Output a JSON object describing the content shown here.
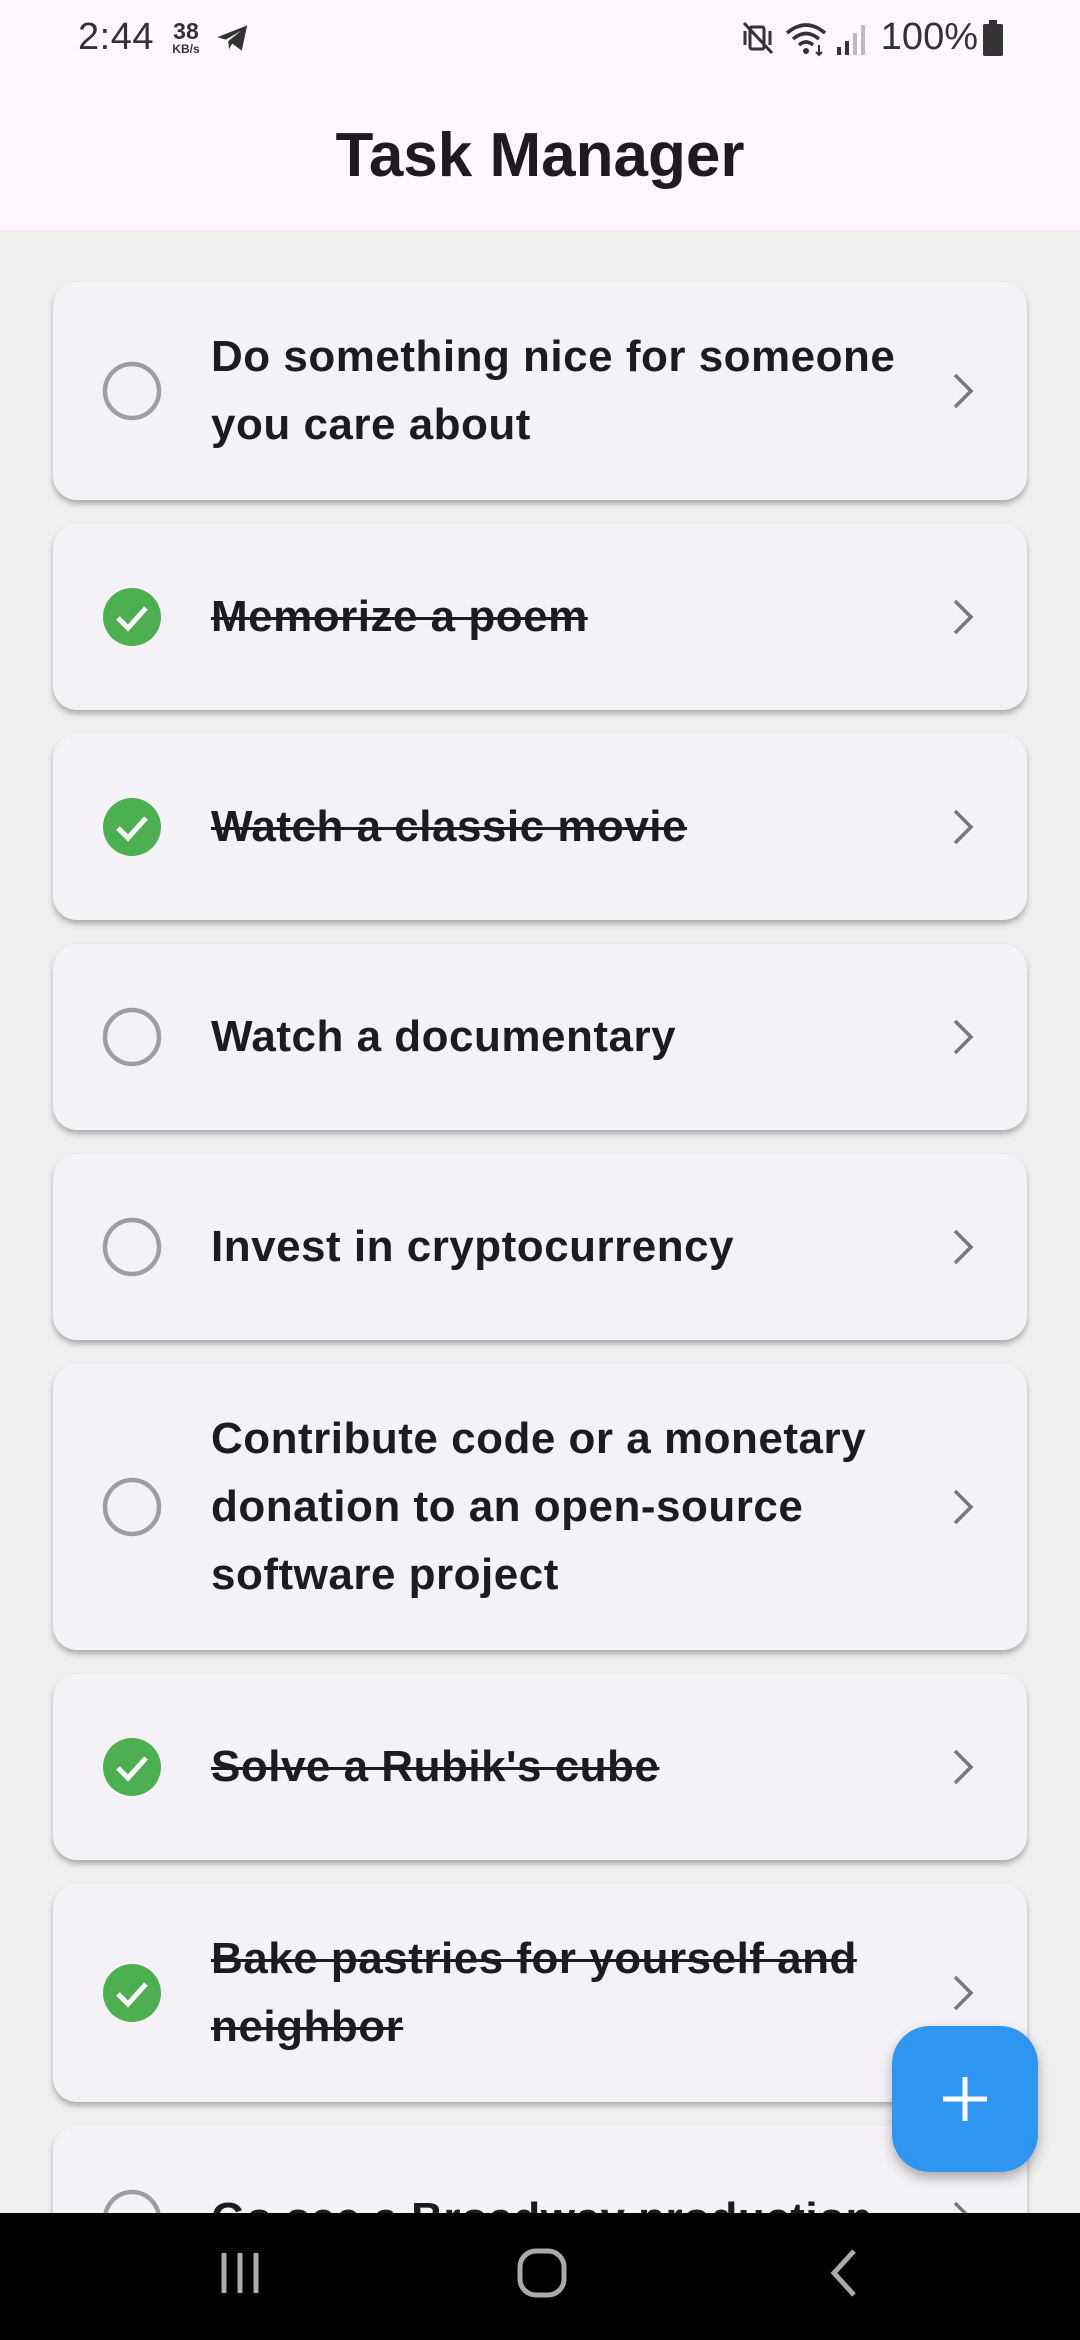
{
  "status_bar": {
    "time": "2:44",
    "net_speed_value": "38",
    "net_speed_unit": "KB/s",
    "battery": "100%"
  },
  "app_bar": {
    "title": "Task Manager"
  },
  "tasks": [
    {
      "title": "Do something nice for someone you care about",
      "completed": false
    },
    {
      "title": "Memorize a poem",
      "completed": true
    },
    {
      "title": "Watch a classic movie",
      "completed": true
    },
    {
      "title": "Watch a documentary",
      "completed": false
    },
    {
      "title": "Invest in cryptocurrency",
      "completed": false
    },
    {
      "title": "Contribute code or a monetary donation to an open-source software project",
      "completed": false
    },
    {
      "title": "Solve a Rubik's cube",
      "completed": true
    },
    {
      "title": "Bake pastries for yourself and neighbor",
      "completed": true
    },
    {
      "title": "Go see a Broadway production",
      "completed": false
    }
  ],
  "icons": {
    "completed": "check-circle-icon",
    "pending": "empty-circle-icon",
    "open": "chevron-right-icon",
    "add": "plus-icon"
  },
  "colors": {
    "completed_green": "#4CAF50",
    "pending_gray": "#9E9E9E",
    "fab_blue": "#2E96F0"
  }
}
